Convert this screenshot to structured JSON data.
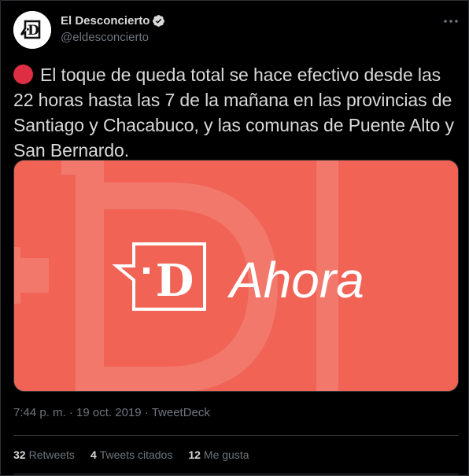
{
  "author": {
    "display_name": "El Desconcierto",
    "handle": "@eldesconcierto",
    "verified": true,
    "avatar_icon": "el-desconcierto-logo-icon"
  },
  "tweet": {
    "emoji": "red-circle",
    "text": "El toque de queda total se hace efectivo desde las 22 horas hasta las 7 de la mañana en las provincias de Santiago y Chacabuco, y las comunas de Puente Alto y San Bernardo."
  },
  "media": {
    "logo_text": "Ahora",
    "background_color": "#f06355",
    "accent_color": "#ffffff"
  },
  "meta": {
    "time": "7:44 p. m.",
    "separator": "·",
    "date": "19 oct. 2019",
    "source": "TweetDeck"
  },
  "stats": {
    "retweets_count": "32",
    "retweets_label": "Retweets",
    "quotes_count": "4",
    "quotes_label": "Tweets citados",
    "likes_count": "12",
    "likes_label": "Me gusta"
  },
  "colors": {
    "background": "#000000",
    "text": "#d9d9d9",
    "secondary_text": "#6e767d",
    "divider": "#2f3336",
    "verified": "#d9d9d9"
  }
}
